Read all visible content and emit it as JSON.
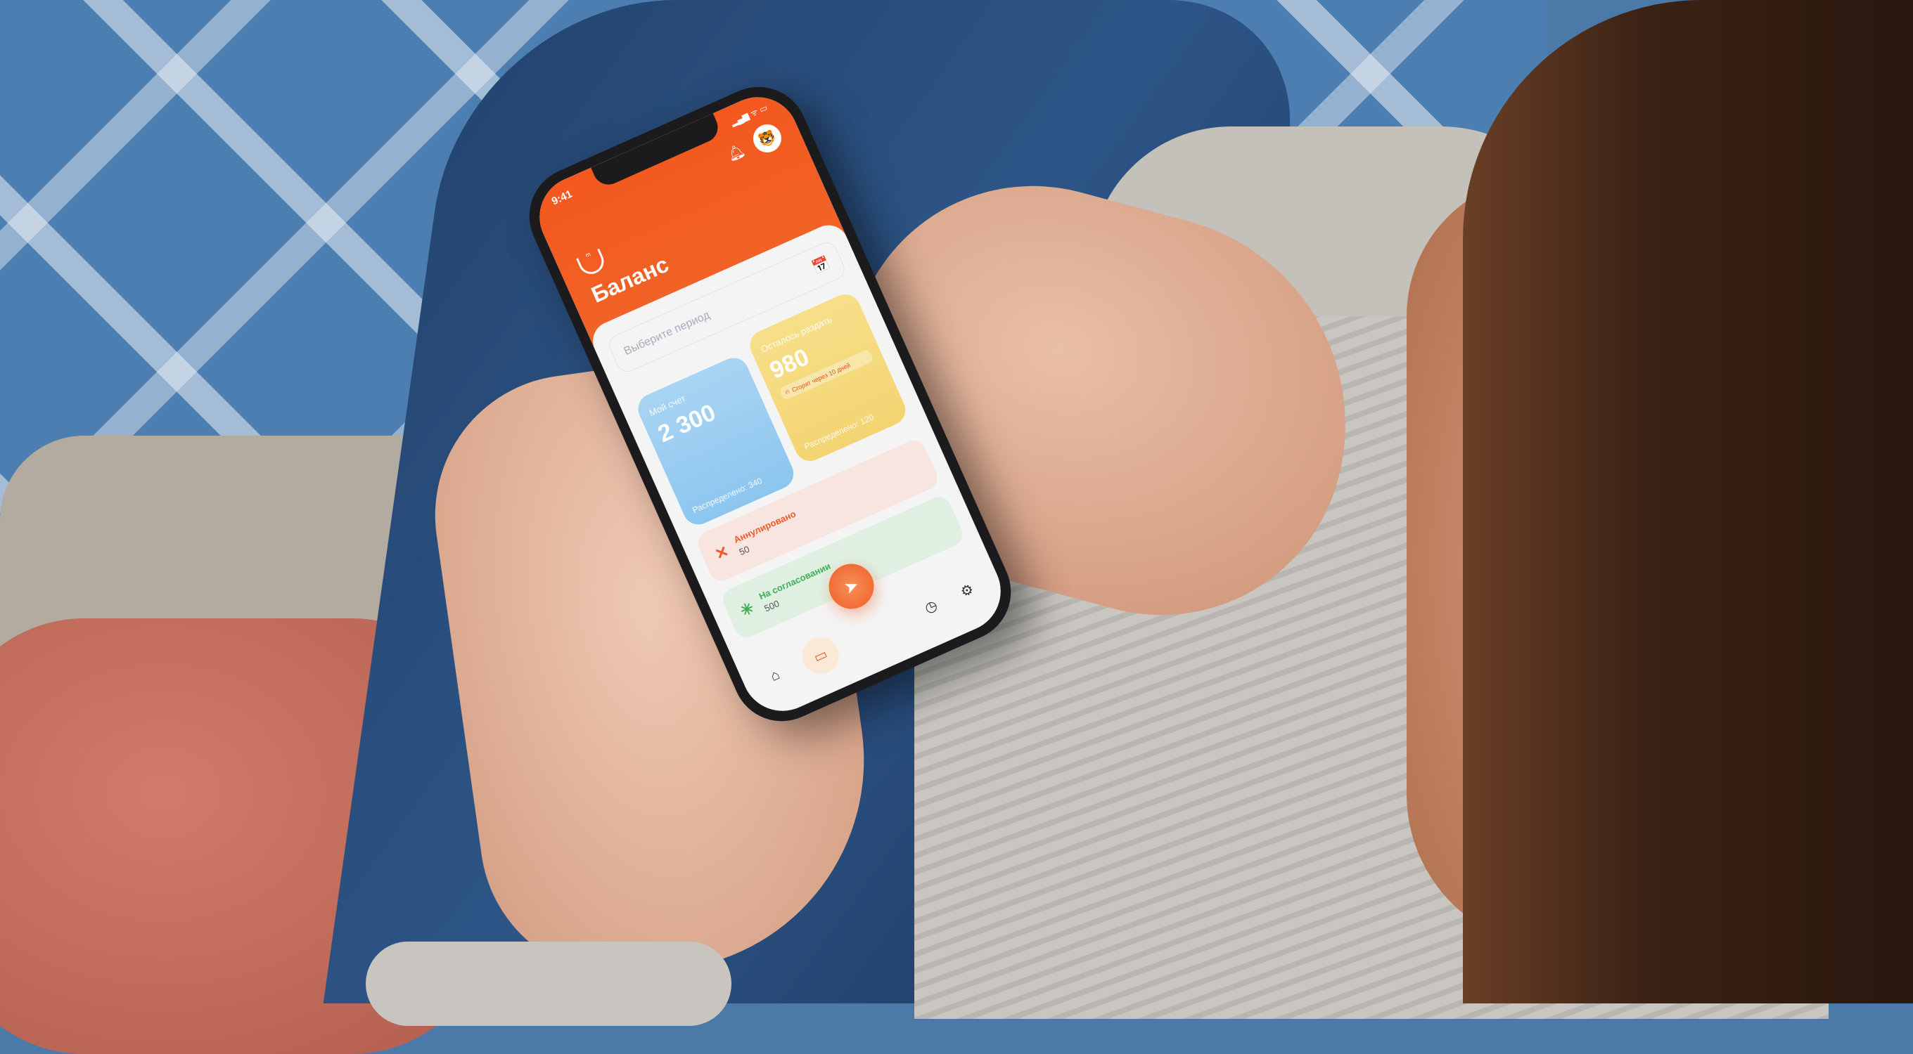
{
  "status_bar": {
    "time": "9:41",
    "signal": "▂▄▆ ᯤ ▭"
  },
  "header": {
    "title": "Баланс",
    "logo_icon": "paw-logo",
    "bell_icon": "bell-icon",
    "avatar_icon": "🐯"
  },
  "period": {
    "placeholder": "Выберите период",
    "calendar_icon": "📅"
  },
  "cards": [
    {
      "label": "Мой счет",
      "value": "2 300",
      "sub": "Распределено: 340",
      "color": "#8cc6ef"
    },
    {
      "label": "Осталось раздать",
      "value": "980",
      "burn": "Сгорят через 10 дней",
      "sub": "Распределено: 120",
      "color": "#f3d472"
    }
  ],
  "rows": [
    {
      "label": "Аннулировано",
      "value": "50",
      "icon": "✕",
      "color": "#ec5a2c"
    },
    {
      "label": "На согласовании",
      "value": "500",
      "icon": "✳",
      "color": "#3fae55"
    }
  ],
  "nav": {
    "home": "⌂",
    "cards": "▭",
    "send": "➤",
    "history": "◷",
    "settings": "⚙"
  },
  "accent": "#f3581f"
}
